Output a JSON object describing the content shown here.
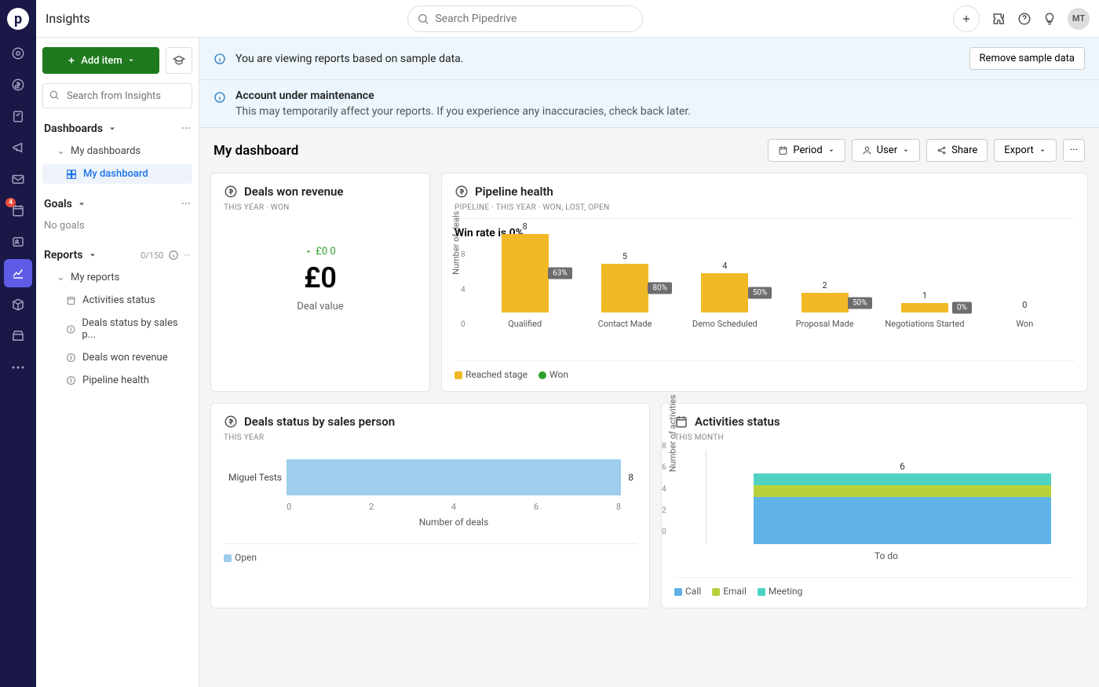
{
  "app": {
    "title": "Insights",
    "search_placeholder": "Search Pipedrive",
    "avatar": "MT"
  },
  "navrail": {
    "badge": "4"
  },
  "sidebar": {
    "add_item": "Add item",
    "search_placeholder": "Search from Insights",
    "dashboards": {
      "label": "Dashboards",
      "my": "My dashboards",
      "selected": "My dashboard"
    },
    "goals": {
      "label": "Goals",
      "empty": "No goals"
    },
    "reports": {
      "label": "Reports",
      "count": "0/150",
      "my": "My reports",
      "items": [
        "Activities status",
        "Deals status by sales p...",
        "Deals won revenue",
        "Pipeline health"
      ]
    }
  },
  "banners": {
    "sample": {
      "text": "You are viewing reports based on sample data.",
      "btn": "Remove sample data"
    },
    "maint": {
      "title": "Account under maintenance",
      "sub": "This may temporarily affect your reports. If you experience any inaccuracies, check back later."
    }
  },
  "dashboard": {
    "title": "My dashboard",
    "ctrls": {
      "period": "Period",
      "user": "User",
      "share": "Share",
      "export": "Export"
    }
  },
  "cards": {
    "revenue": {
      "title": "Deals won revenue",
      "sub": "THIS YEAR  ·  WON",
      "delta": "£0 0",
      "value": "£0",
      "label": "Deal value"
    },
    "pipeline": {
      "title": "Pipeline health",
      "sub": "PIPELINE  ·  THIS YEAR  ·  WON, LOST, OPEN",
      "winrate": "Win rate is 0%",
      "ylabel": "Number of deals",
      "legend": [
        "Reached stage",
        "Won"
      ]
    },
    "status": {
      "title": "Deals status by sales person",
      "sub": "THIS YEAR",
      "ylabel": "Number of deals",
      "legend": [
        "Open"
      ]
    },
    "activities": {
      "title": "Activities status",
      "sub": "THIS MONTH",
      "ylabel": "Number of activities",
      "legend": [
        "Call",
        "Email",
        "Meeting"
      ],
      "cat": "To do"
    }
  },
  "chart_data": [
    {
      "id": "pipeline",
      "type": "bar",
      "ylabel": "Number of deals",
      "ylim": [
        0,
        8
      ],
      "yticks": [
        0,
        4,
        8
      ],
      "categories": [
        "Qualified",
        "Contact Made",
        "Demo Scheduled",
        "Proposal Made",
        "Negotiations Started",
        "Won"
      ],
      "values": [
        8,
        5,
        4,
        2,
        1,
        0
      ],
      "conversion_pct": [
        "63%",
        "80%",
        "50%",
        "50%",
        "0%"
      ],
      "series_colors": {
        "reached": "#f2b927",
        "won": "#2ca02c"
      }
    },
    {
      "id": "deals_status",
      "type": "bar",
      "orientation": "horizontal",
      "xlabel": "Number of deals",
      "xlim": [
        0,
        8
      ],
      "xticks": [
        0,
        2,
        4,
        6,
        8
      ],
      "categories": [
        "Miguel Tests"
      ],
      "values": [
        8
      ],
      "color": "#9ecded"
    },
    {
      "id": "activities",
      "type": "bar",
      "stacked": true,
      "ylabel": "Number of activities",
      "ylim": [
        0,
        8
      ],
      "yticks": [
        0,
        2,
        4,
        6,
        8
      ],
      "categories": [
        "To do"
      ],
      "series": [
        {
          "name": "Call",
          "value": 4,
          "color": "#5fb3e6"
        },
        {
          "name": "Email",
          "value": 1,
          "color": "#b9d23c"
        },
        {
          "name": "Meeting",
          "value": 1,
          "color": "#4fd2c2"
        }
      ],
      "total": 6
    }
  ]
}
